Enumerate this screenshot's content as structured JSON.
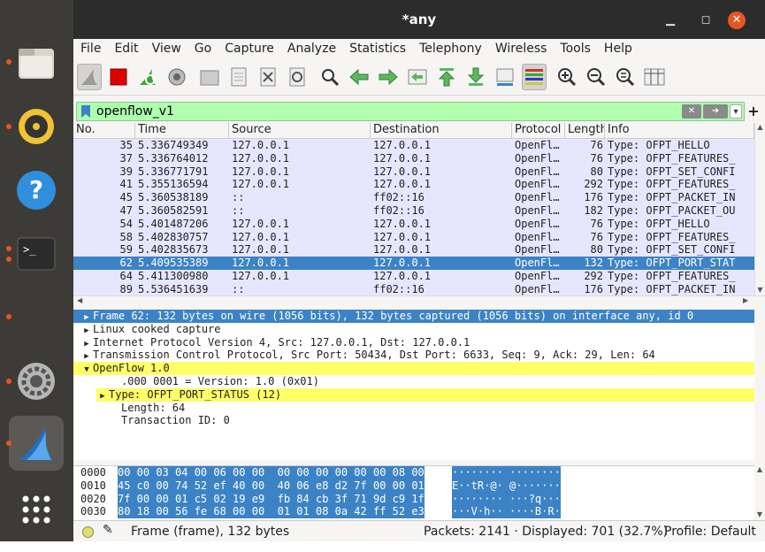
{
  "window": {
    "title": "*any"
  },
  "menu": [
    "File",
    "Edit",
    "View",
    "Go",
    "Capture",
    "Analyze",
    "Statistics",
    "Telephony",
    "Wireless",
    "Tools",
    "Help"
  ],
  "filter": {
    "value": "openflow_v1"
  },
  "columns": [
    "No.",
    "Time",
    "Source",
    "Destination",
    "Protocol",
    "Length",
    "Info"
  ],
  "packets": [
    {
      "no": "35",
      "time": "5.336749349",
      "src": "127.0.0.1",
      "dst": "127.0.0.1",
      "proto": "OpenFl…",
      "len": "76",
      "info": "Type: OFPT_HELLO"
    },
    {
      "no": "37",
      "time": "5.336764012",
      "src": "127.0.0.1",
      "dst": "127.0.0.1",
      "proto": "OpenFl…",
      "len": "76",
      "info": "Type: OFPT_FEATURES_"
    },
    {
      "no": "39",
      "time": "5.336771791",
      "src": "127.0.0.1",
      "dst": "127.0.0.1",
      "proto": "OpenFl…",
      "len": "80",
      "info": "Type: OFPT_SET_CONFI"
    },
    {
      "no": "41",
      "time": "5.355136594",
      "src": "127.0.0.1",
      "dst": "127.0.0.1",
      "proto": "OpenFl…",
      "len": "292",
      "info": "Type: OFPT_FEATURES_"
    },
    {
      "no": "45",
      "time": "5.360538189",
      "src": "::",
      "dst": "ff02::16",
      "proto": "OpenFl…",
      "len": "176",
      "info": "Type: OFPT_PACKET_IN"
    },
    {
      "no": "47",
      "time": "5.360582591",
      "src": "::",
      "dst": "ff02::16",
      "proto": "OpenFl…",
      "len": "182",
      "info": "Type: OFPT_PACKET_OU"
    },
    {
      "no": "54",
      "time": "5.401487206",
      "src": "127.0.0.1",
      "dst": "127.0.0.1",
      "proto": "OpenFl…",
      "len": "76",
      "info": "Type: OFPT_HELLO"
    },
    {
      "no": "58",
      "time": "5.402830757",
      "src": "127.0.0.1",
      "dst": "127.0.0.1",
      "proto": "OpenFl…",
      "len": "76",
      "info": "Type: OFPT_FEATURES_"
    },
    {
      "no": "59",
      "time": "5.402835673",
      "src": "127.0.0.1",
      "dst": "127.0.0.1",
      "proto": "OpenFl…",
      "len": "80",
      "info": "Type: OFPT_SET_CONFI"
    },
    {
      "no": "62",
      "time": "5.409535389",
      "src": "127.0.0.1",
      "dst": "127.0.0.1",
      "proto": "OpenFl…",
      "len": "132",
      "info": "Type: OFPT_PORT_STAT",
      "selected": true
    },
    {
      "no": "64",
      "time": "5.411300980",
      "src": "127.0.0.1",
      "dst": "127.0.0.1",
      "proto": "OpenFl…",
      "len": "292",
      "info": "Type: OFPT_FEATURES_"
    },
    {
      "no": "89",
      "time": "5.536451639",
      "src": "::",
      "dst": "ff02::16",
      "proto": "OpenFl…",
      "len": "176",
      "info": "Type: OFPT_PACKET_IN"
    }
  ],
  "details": [
    {
      "text": "Frame 62: 132 bytes on wire (1056 bits), 132 bytes captured (1056 bits) on interface any, id 0",
      "indent": 0,
      "arrow": "collapsed",
      "style": "sel"
    },
    {
      "text": "Linux cooked capture",
      "indent": 0,
      "arrow": "collapsed",
      "style": ""
    },
    {
      "text": "Internet Protocol Version 4, Src: 127.0.0.1, Dst: 127.0.0.1",
      "indent": 0,
      "arrow": "collapsed",
      "style": ""
    },
    {
      "text": "Transmission Control Protocol, Src Port: 50434, Dst Port: 6633, Seq: 9, Ack: 29, Len: 64",
      "indent": 0,
      "arrow": "collapsed",
      "style": ""
    },
    {
      "text": "OpenFlow 1.0",
      "indent": 0,
      "arrow": "expanded",
      "style": "yel"
    },
    {
      "text": ".000 0001 = Version: 1.0 (0x01)",
      "indent": 2,
      "arrow": "none",
      "style": ""
    },
    {
      "text": "Type: OFPT_PORT_STATUS (12)",
      "indent": 1,
      "arrow": "collapsed",
      "style": "yel"
    },
    {
      "text": "Length: 64",
      "indent": 2,
      "arrow": "none",
      "style": ""
    },
    {
      "text": "Transaction ID: 0",
      "indent": 2,
      "arrow": "none",
      "style": ""
    }
  ],
  "bytes": [
    {
      "off": "0000",
      "hex": "00 00 03 04 00 06 00 00  00 00 00 00 00 00 08 00",
      "asc": "········ ········"
    },
    {
      "off": "0010",
      "hex": "45 c0 00 74 52 ef 40 00  40 06 e8 d2 7f 00 00 01",
      "asc": "E··tR·@· @·······"
    },
    {
      "off": "0020",
      "hex": "7f 00 00 01 c5 02 19 e9  fb 84 cb 3f 71 9d c9 1f",
      "asc": "········ ···?q···"
    },
    {
      "off": "0030",
      "hex": "80 18 00 56 fe 68 00 00  01 01 08 0a 42 ff 52 e3",
      "asc": "···V·h·· ····B·R·"
    }
  ],
  "status": {
    "frame": "Frame (frame), 132 bytes",
    "packets": "Packets: 2141 · Displayed: 701 (32.7%)",
    "profile": "Profile: Default"
  }
}
